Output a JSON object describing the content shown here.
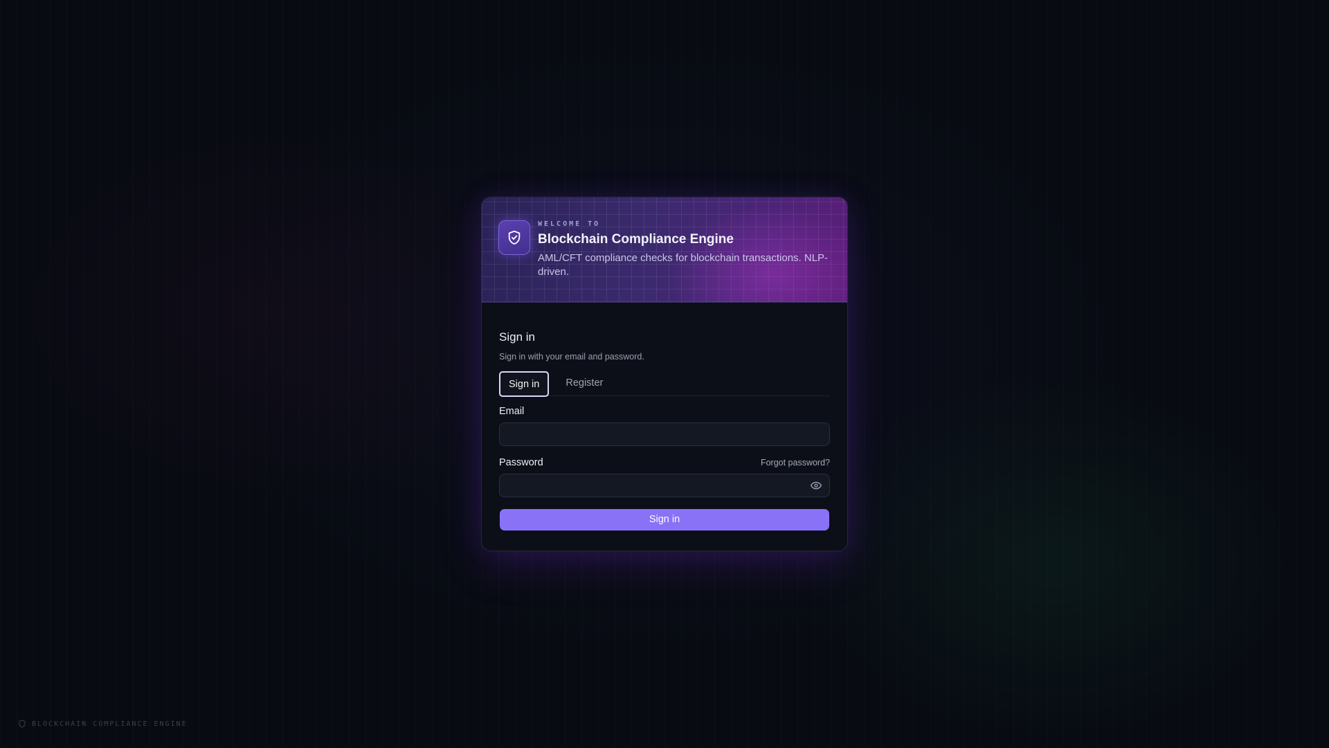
{
  "hero": {
    "eyebrow": "WELCOME TO",
    "title": "Blockchain Compliance Engine",
    "subtitle": "AML/CFT compliance checks for blockchain transactions. NLP-driven.",
    "logo_icon": "shield-check-icon"
  },
  "auth": {
    "heading": "Sign in",
    "description": "Sign in with your email and password.",
    "tabs": [
      {
        "label": "Sign in",
        "active": true
      },
      {
        "label": "Register",
        "active": false
      }
    ],
    "email_label": "Email",
    "email_value": "",
    "password_label": "Password",
    "password_value": "",
    "forgot_label": "Forgot password?",
    "toggle_visibility_icon": "eye-icon",
    "submit_label": "Sign in"
  },
  "footer": {
    "label": "BLOCKCHAIN COMPLIANCE ENGINE",
    "icon": "shield-icon"
  },
  "colors": {
    "accent": "#8a72f7",
    "background": "#080b12",
    "card": "#0c0f17"
  }
}
